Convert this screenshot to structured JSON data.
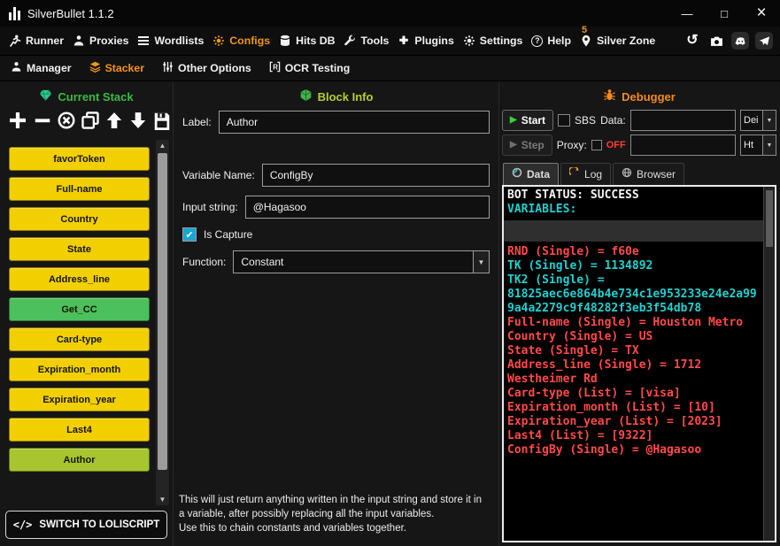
{
  "window": {
    "title": "SilverBullet 1.1.2",
    "controls": {
      "minimize": "—",
      "maximize": "□",
      "close": "×"
    }
  },
  "menubar": {
    "items": [
      {
        "label": "Runner"
      },
      {
        "label": "Proxies"
      },
      {
        "label": "Wordlists"
      },
      {
        "label": "Configs"
      },
      {
        "label": "Hits DB"
      },
      {
        "label": "Tools"
      },
      {
        "label": "Plugins"
      },
      {
        "label": "Settings"
      },
      {
        "label": "Help"
      },
      {
        "label": "Silver Zone",
        "badge": "5"
      }
    ]
  },
  "subnav": {
    "items": [
      {
        "label": "Manager"
      },
      {
        "label": "Stacker"
      },
      {
        "label": "Other Options"
      },
      {
        "label": "OCR Testing"
      }
    ]
  },
  "stack": {
    "title": "Current Stack",
    "blocks": [
      {
        "label": "favorToken",
        "color": "#f2cf00"
      },
      {
        "label": "Full-name",
        "color": "#f2cf00"
      },
      {
        "label": "Country",
        "color": "#f2cf00"
      },
      {
        "label": "State",
        "color": "#f2cf00"
      },
      {
        "label": "Address_line",
        "color": "#f2cf00"
      },
      {
        "label": "Get_CC",
        "color": "#4cc05c"
      },
      {
        "label": "Card-type",
        "color": "#f2cf00"
      },
      {
        "label": "Expiration_month",
        "color": "#f2cf00"
      },
      {
        "label": "Expiration_year",
        "color": "#f2cf00"
      },
      {
        "label": "Last4",
        "color": "#f2cf00"
      },
      {
        "label": "Author",
        "color": "#a8c52f"
      }
    ],
    "switch_button": {
      "icon": "</>",
      "label": "SWITCH TO LOLISCRIPT"
    }
  },
  "block_info": {
    "title": "Block Info",
    "label_field": {
      "label": "Label:",
      "value": "Author"
    },
    "variable_name_field": {
      "label": "Variable Name:",
      "value": "ConfigBy"
    },
    "input_string_field": {
      "label": "Input string:",
      "value": "@Hagasoo"
    },
    "is_capture": {
      "label": "Is Capture",
      "checked": true
    },
    "function_field": {
      "label": "Function:",
      "value": "Constant"
    },
    "description_line1": "This will just return anything written in the input string and store it in a variable, after possibly replacing all the input variables.",
    "description_line2": "Use this to chain constants and variables together."
  },
  "debugger": {
    "title": "Debugger",
    "start_button": "Start",
    "step_button": "Step",
    "sbs_label": "SBS",
    "data_label": "Data:",
    "data_type": "Dei",
    "proxy_label": "Proxy:",
    "proxy_off": "OFF",
    "proxy_type": "Ht",
    "tabs": [
      {
        "label": "Data",
        "active": true
      },
      {
        "label": "Log",
        "active": false
      },
      {
        "label": "Browser",
        "active": false
      }
    ],
    "log_lines": [
      {
        "text": "BOT STATUS: SUCCESS",
        "color": "#f5f5f5"
      },
      {
        "text": "VARIABLES:",
        "color": "#21d0d0"
      },
      {
        "text": "",
        "color": "#f5f5f5"
      },
      {
        "text": "RND (Single) = f60e",
        "color": "#ff4949"
      },
      {
        "text": "TK (Single) = 1134892",
        "color": "#21d0d0"
      },
      {
        "text": "TK2 (Single) = 81825aec6e864b4e734c1e953233e24e2a999a4a2279c9f48282f3eb3f54db78",
        "color": "#21d0d0"
      },
      {
        "text": "Full-name (Single) = Houston Metro",
        "color": "#ff4949"
      },
      {
        "text": "Country (Single) = US",
        "color": "#ff4949"
      },
      {
        "text": "State (Single) = TX",
        "color": "#ff4949"
      },
      {
        "text": "Address_line (Single) = 1712 Westheimer Rd",
        "color": "#ff4949"
      },
      {
        "text": "Card-type (List) = [visa]",
        "color": "#ff4949"
      },
      {
        "text": "Expiration_month (List) = [10]",
        "color": "#ff4949"
      },
      {
        "text": "Expiration_year (List) = [2023]",
        "color": "#ff4949"
      },
      {
        "text": "Last4 (List) = [9322]",
        "color": "#ff4949"
      },
      {
        "text": "ConfigBy (Single) = @Hagasoo",
        "color": "#ff4949"
      }
    ]
  },
  "icons": {
    "caret_down": "▼",
    "scroll_up": "▲",
    "scroll_down": "▼",
    "play": "▶",
    "check": "✔",
    "question": "?",
    "history": "↺"
  },
  "colors": {
    "accent_orange": "#f49511",
    "stack_green": "#3cb944",
    "block_info_lime": "#b7cf2a",
    "log_cyan": "#21d0d0",
    "log_red": "#ff4949"
  }
}
